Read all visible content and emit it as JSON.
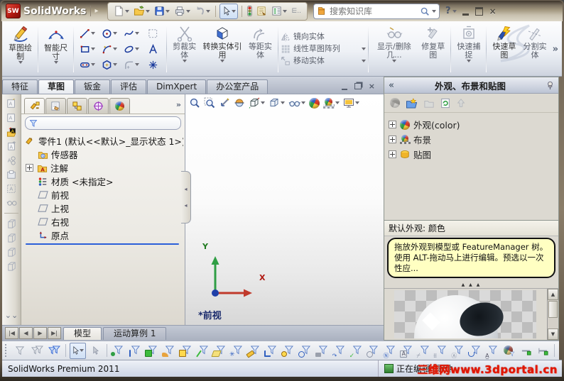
{
  "colors": {
    "brand_red": "#b01810",
    "accent_navy": "#1a3a9c",
    "hint_bg": "#ffffc2",
    "rollback_blue": "#2b5fd9",
    "watermark_red": "#e51400"
  },
  "icons": {
    "collapse": "«",
    "overflow": "»",
    "help": "?",
    "close": "×",
    "menu_arrow": "▸",
    "nav_first": "|◀",
    "nav_prev": "◀",
    "nav_next": "▶",
    "nav_last": "▶|",
    "splitter_arrow": "◂",
    "pane_splitter": "▲ ▲ ▲"
  },
  "titlebar": {
    "app_name": "SolidWorks",
    "search_placeholder": "搜索知识库"
  },
  "command_tabs": {
    "active": "草图",
    "items": [
      {
        "label": "特征"
      },
      {
        "label": "草图"
      },
      {
        "label": "钣金"
      },
      {
        "label": "评估"
      },
      {
        "label": "DimXpert"
      },
      {
        "label": "办公室产品"
      }
    ]
  },
  "ribbon": {
    "sketch_label": "草图绘制",
    "smart_dimension_label": "智能尺寸",
    "trim_label": "剪裁实体",
    "convert_label": "转换实体引用",
    "offset_label": "等距实体",
    "mirror_label": "镜向实体",
    "linear_pattern_label": "线性草图阵列",
    "move_label": "移动实体",
    "display_delete_label": "显示/删除几...",
    "repair_label": "修复草图",
    "quick_snaps_label": "快速捕捉",
    "rapid_sketch_label": "快速草图",
    "split_label": "分割实体"
  },
  "feature_tree": {
    "root": "零件1 (默认<<默认>_显示状态 1>)",
    "items": [
      {
        "label": "传感器"
      },
      {
        "label": "注解"
      },
      {
        "label": "材质 <未指定>"
      },
      {
        "label": "前视"
      },
      {
        "label": "上视"
      },
      {
        "label": "右视"
      },
      {
        "label": "原点"
      }
    ]
  },
  "graphics": {
    "view_label": "*前视",
    "axis_x": "X",
    "axis_y": "Y"
  },
  "task_pane": {
    "title": "外观、布景和贴图",
    "tree": [
      {
        "label": "外观(color)"
      },
      {
        "label": "布景"
      },
      {
        "label": "贴图"
      }
    ],
    "selection_header": "默认外观: 颜色",
    "hint": "拖放外观到模型或 FeatureManager 树。使用 ALT-拖动马上进行编辑。预选以一次性应..."
  },
  "doc_tabs": {
    "items": [
      {
        "label": "模型"
      },
      {
        "label": "运动算例 1"
      }
    ]
  },
  "statusbar": {
    "left": "SolidWorks Premium 2011",
    "editing": "正在编辑: 零件",
    "watermark": "三维网www.3dportal.cn"
  }
}
